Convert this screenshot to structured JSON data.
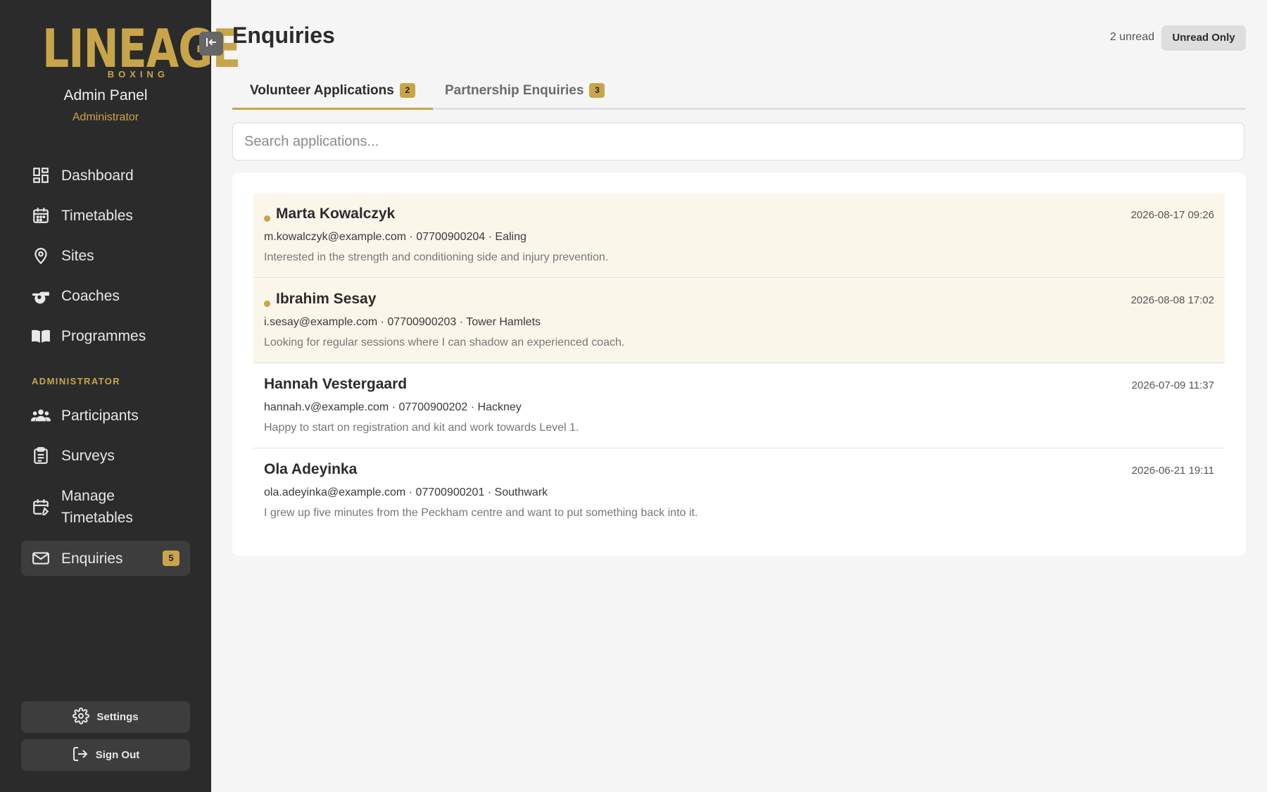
{
  "brand": {
    "logo_text": "LINEAGE",
    "logo_sub": "BOXING",
    "panel_title": "Admin Panel",
    "role": "Administrator",
    "accent": "#c9a54a"
  },
  "nav": {
    "items": [
      {
        "label": "Dashboard",
        "icon": "dashboard-icon"
      },
      {
        "label": "Timetables",
        "icon": "calendar-icon"
      },
      {
        "label": "Sites",
        "icon": "location-pin-icon"
      },
      {
        "label": "Coaches",
        "icon": "whistle-icon"
      },
      {
        "label": "Programmes",
        "icon": "book-icon"
      }
    ],
    "admin_section_label": "ADMINISTRATOR",
    "admin_items": [
      {
        "label": "Participants",
        "icon": "people-icon"
      },
      {
        "label": "Surveys",
        "icon": "clipboard-icon"
      },
      {
        "label": "Manage Timetables",
        "icon": "calendar-edit-icon"
      },
      {
        "label": "Enquiries",
        "icon": "mail-icon",
        "badge": "5",
        "active": true
      }
    ],
    "settings_label": "Settings",
    "signout_label": "Sign Out"
  },
  "header": {
    "title": "Enquiries",
    "unread_text": "2 unread",
    "unread_only_label": "Unread Only"
  },
  "tabs": [
    {
      "label": "Volunteer Applications",
      "badge": "2",
      "active": true
    },
    {
      "label": "Partnership Enquiries",
      "badge": "3",
      "active": false
    }
  ],
  "search": {
    "placeholder": "Search applications..."
  },
  "applications": [
    {
      "name": "Marta Kowalczyk",
      "date": "2026-08-17 09:26",
      "meta": "m.kowalczyk@example.com · 07700900204 · Ealing",
      "message": "Interested in the strength and conditioning side and injury prevention.",
      "unread": true
    },
    {
      "name": "Ibrahim Sesay",
      "date": "2026-08-08 17:02",
      "meta": "i.sesay@example.com · 07700900203 · Tower Hamlets",
      "message": "Looking for regular sessions where I can shadow an experienced coach.",
      "unread": true
    },
    {
      "name": "Hannah Vestergaard",
      "date": "2026-07-09 11:37",
      "meta": "hannah.v@example.com · 07700900202 · Hackney",
      "message": "Happy to start on registration and kit and work towards Level 1.",
      "unread": false
    },
    {
      "name": "Ola Adeyinka",
      "date": "2026-06-21 19:11",
      "meta": "ola.adeyinka@example.com · 07700900201 · Southwark",
      "message": "I grew up five minutes from the Peckham centre and want to put something back into it.",
      "unread": false
    }
  ]
}
